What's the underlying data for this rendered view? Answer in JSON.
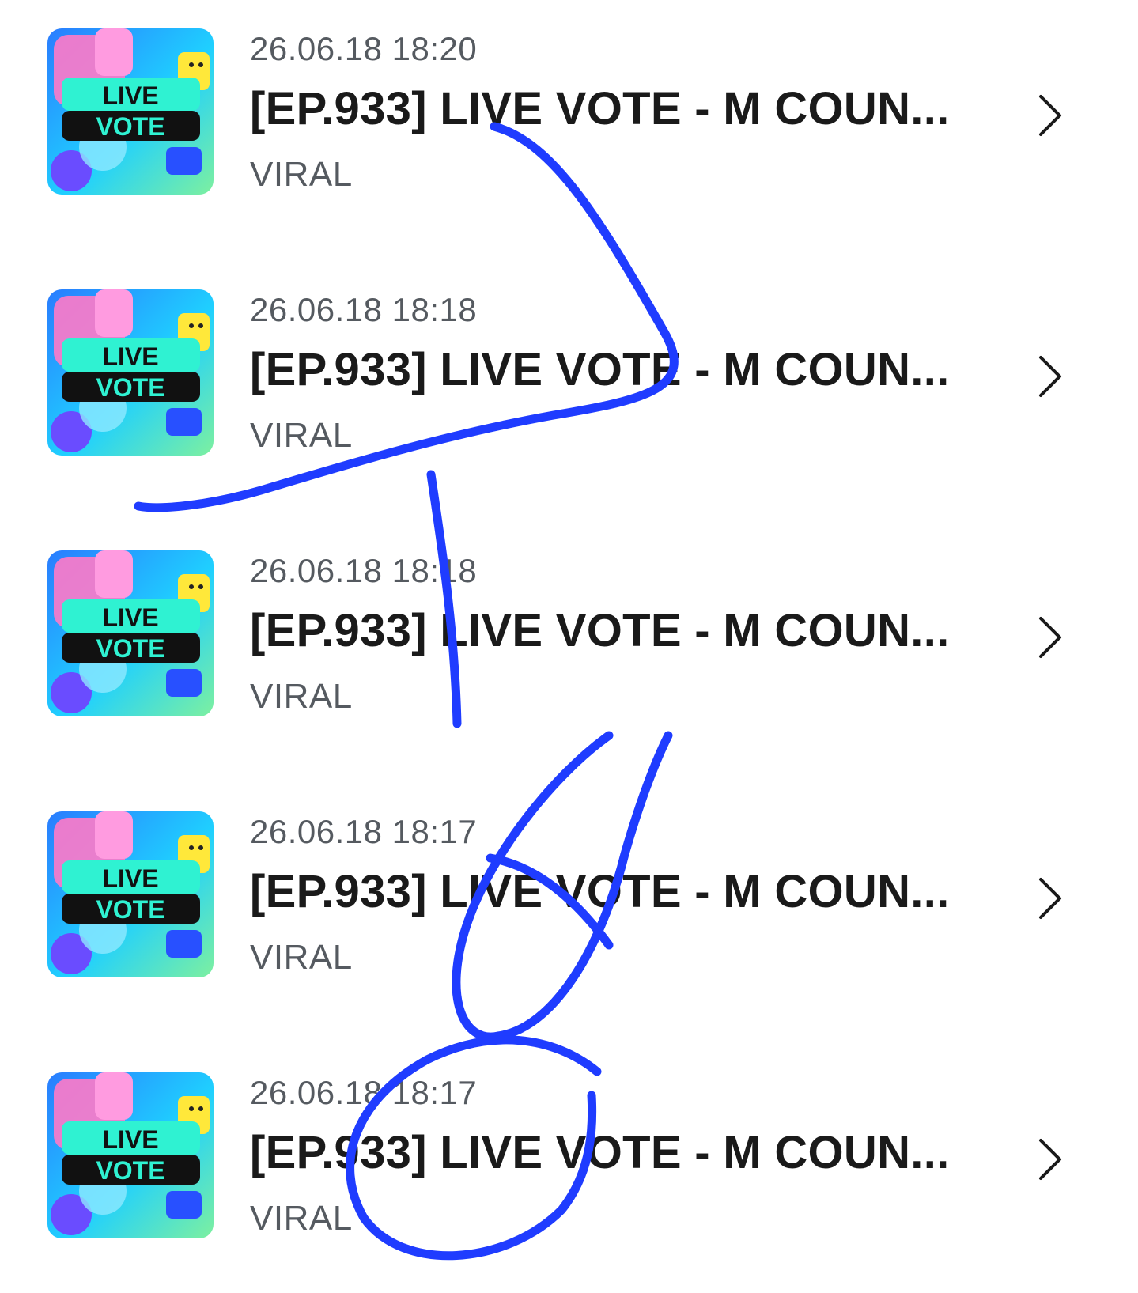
{
  "items": [
    {
      "date": "26.06.18 18:20",
      "title": "[EP.933] LIVE VOTE - M COUN...",
      "category": "VIRAL",
      "thumb_line1": "LIVE",
      "thumb_line2": "VOTE"
    },
    {
      "date": "26.06.18 18:18",
      "title": "[EP.933] LIVE VOTE - M COUN...",
      "category": "VIRAL",
      "thumb_line1": "LIVE",
      "thumb_line2": "VOTE"
    },
    {
      "date": "26.06.18 18:18",
      "title": "[EP.933] LIVE VOTE - M COUN...",
      "category": "VIRAL",
      "thumb_line1": "LIVE",
      "thumb_line2": "VOTE"
    },
    {
      "date": "26.06.18 18:17",
      "title": "[EP.933] LIVE VOTE - M COUN...",
      "category": "VIRAL",
      "thumb_line1": "LIVE",
      "thumb_line2": "VOTE"
    },
    {
      "date": "26.06.18 18:17",
      "title": "[EP.933] LIVE VOTE - M COUN...",
      "category": "VIRAL",
      "thumb_line1": "LIVE",
      "thumb_line2": "VOTE"
    }
  ],
  "icons": {
    "chevron": "chevron-right-icon",
    "thumbnail": "live-vote-thumbnail"
  },
  "colors": {
    "scribble": "#1f3cff",
    "date_text": "#555a60",
    "title_text": "#1a1a1a",
    "thumb_banner": "#2ff2d2"
  }
}
